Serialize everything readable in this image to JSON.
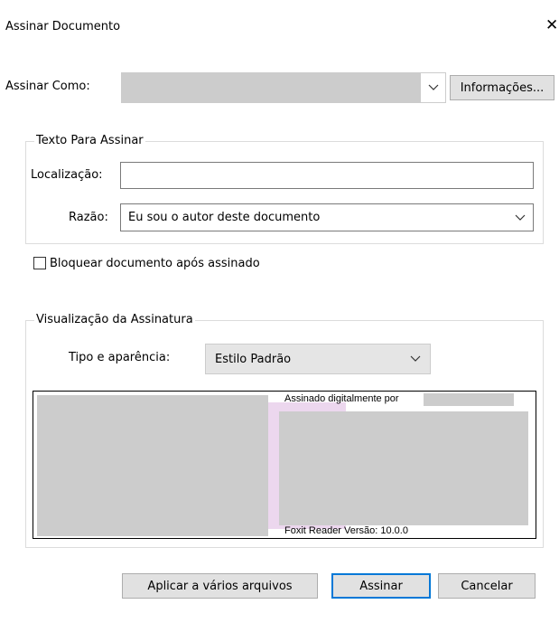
{
  "window": {
    "title": "Assinar Documento",
    "close_glyph": "✕"
  },
  "sign_as": {
    "label": "Assinar Como:",
    "value": "",
    "info_button": "Informações..."
  },
  "text_group": {
    "legend": "Texto Para Assinar",
    "location_label": "Localização:",
    "location_value": "",
    "reason_label": "Razão:",
    "reason_value": "Eu sou o autor deste documento"
  },
  "lock": {
    "label": "Bloquear documento após assinado",
    "checked": false
  },
  "preview_group": {
    "legend": "Visualização da Assinatura",
    "type_label": "Tipo e aparência:",
    "type_value": "Estilo Padrão",
    "signed_by": "Assinado digitalmente por",
    "version": "Foxit Reader Versão: 10.0.0"
  },
  "buttons": {
    "apply_multi": "Aplicar a vários arquivos",
    "sign": "Assinar",
    "cancel": "Cancelar"
  },
  "icons": {
    "chevron": "chevron-down-icon",
    "close": "close-icon",
    "checkbox": "checkbox-icon"
  },
  "colors": {
    "accent": "#0078d7",
    "button_bg": "#e1e1e1",
    "placeholder_gray": "#cccccc",
    "watermark": "#e7cdea"
  }
}
